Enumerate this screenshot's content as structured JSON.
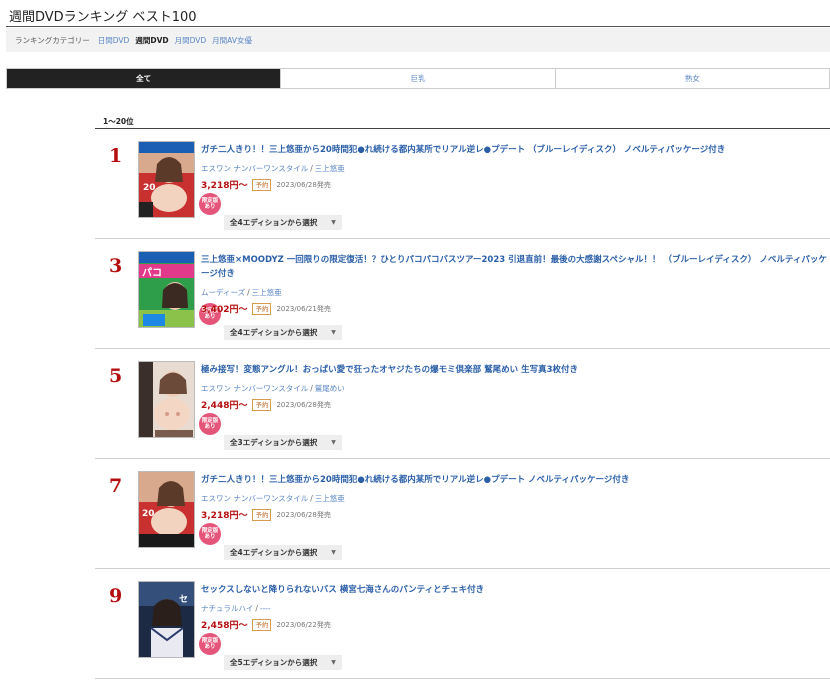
{
  "page_title": "週間DVDランキング ベスト100",
  "category_bar": {
    "label": "ランキングカテゴリー",
    "links": [
      {
        "label": "日間DVD",
        "active": false
      },
      {
        "label": "週間DVD",
        "active": true
      },
      {
        "label": "月間DVD",
        "active": false
      },
      {
        "label": "月間AV女優",
        "active": false
      }
    ]
  },
  "tabs": [
    {
      "label": "全て",
      "active": true
    },
    {
      "label": "巨乳",
      "active": false
    },
    {
      "label": "熟女",
      "active": false
    }
  ],
  "range_label": "1〜20位",
  "badge_text": [
    "限定版",
    "あり"
  ],
  "status_label": "予約",
  "items": [
    {
      "rank": "1",
      "title": "ガチ二人きり！！三上悠亜から20時間犯●れ続ける都内某所でリアル逆レ●プデート （ブルーレイディスク） ノベルティパッケージ付き",
      "maker": "エスワン ナンバーワンスタイル",
      "actress": "三上悠亜",
      "price": "3,218円〜",
      "release_date": "2023/06/28発売",
      "edition": "全4エディションから選択"
    },
    {
      "rank": "3",
      "title": "三上悠亜×MOODYZ 一回限りの限定復活！？ひとりパコパコバスツアー2023 引退直前！最後の大感謝スペシャル！！ （ブルーレイディスク） ノベルティパッケージ付き",
      "maker": "ムーディーズ",
      "actress": "三上悠亜",
      "price": "3,402円〜",
      "release_date": "2023/06/21発売",
      "edition": "全4エディションから選択"
    },
    {
      "rank": "5",
      "title": "極み接写！変態アングル！おっぱい愛で狂ったオヤジたちの爆モミ倶楽部 鷲尾めい 生写真3枚付き",
      "maker": "エスワン ナンバーワンスタイル",
      "actress": "鷲尾めい",
      "price": "2,448円〜",
      "release_date": "2023/06/28発売",
      "edition": "全3エディションから選択"
    },
    {
      "rank": "7",
      "title": "ガチ二人きり！！三上悠亜から20時間犯●れ続ける都内某所でリアル逆レ●プデート ノベルティパッケージ付き",
      "maker": "エスワン ナンバーワンスタイル",
      "actress": "三上悠亜",
      "price": "3,218円〜",
      "release_date": "2023/06/28発売",
      "edition": "全4エディションから選択"
    },
    {
      "rank": "9",
      "title": "セックスしないと降りられないバス 横宮七海さんのパンティとチェキ付き",
      "maker": "ナチュラルハイ",
      "actress": "----",
      "price": "2,458円〜",
      "release_date": "2023/06/22発売",
      "edition": "全5エディションから選択"
    }
  ],
  "colors": {
    "rank": "#b50e0e",
    "title_link": "#2b5fa8",
    "meta_link": "#5b86c5",
    "badge": "#e5557a",
    "active_tab": "#222222"
  }
}
